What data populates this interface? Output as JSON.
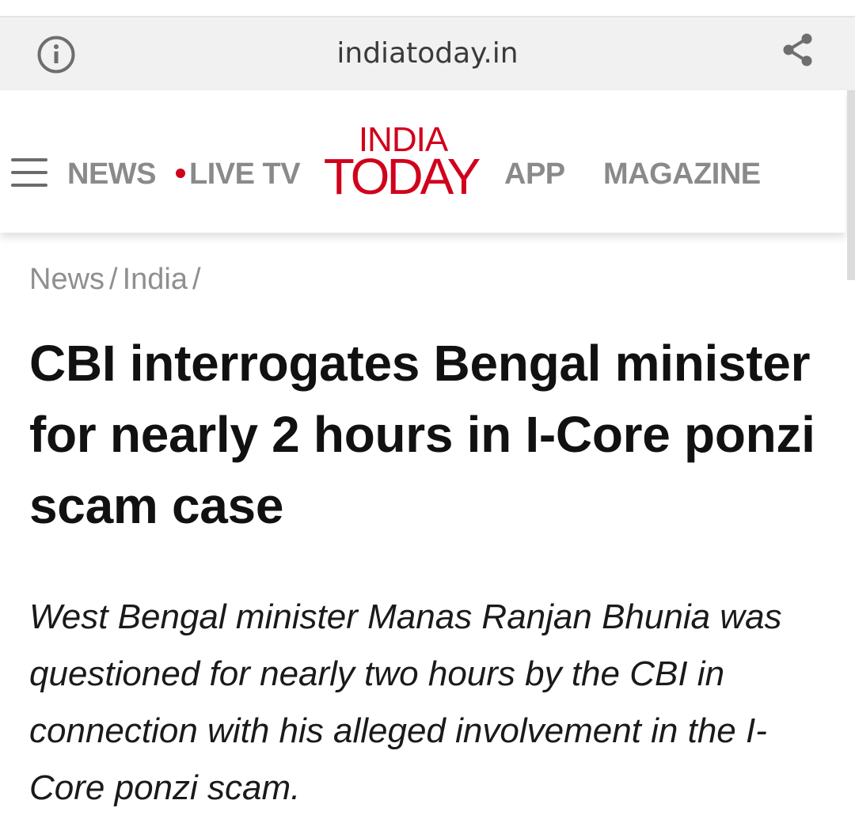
{
  "browser": {
    "url": "indiatoday.in",
    "icons": {
      "info": "info-icon",
      "share": "share-icon"
    }
  },
  "header": {
    "menu_icon": "hamburger-menu-icon",
    "nav": {
      "news": "NEWS",
      "live_tv": "LIVE TV",
      "app": "APP",
      "magazine": "MAGAZINE"
    },
    "logo": {
      "line1": "INDIA",
      "line2": "TODAY"
    },
    "colors": {
      "brand_red": "#d0021b",
      "nav_gray": "#8a8a8a"
    }
  },
  "breadcrumb": {
    "items": [
      "News",
      "India"
    ],
    "separator": "/"
  },
  "article": {
    "headline": "CBI interrogates Bengal minister for nearly 2 hours in I-Core ponzi scam case",
    "summary": "West Bengal minister Manas Ranjan Bhunia was questioned for nearly two hours by the CBI in connection with his alleged involvement in the I-Core ponzi scam."
  }
}
